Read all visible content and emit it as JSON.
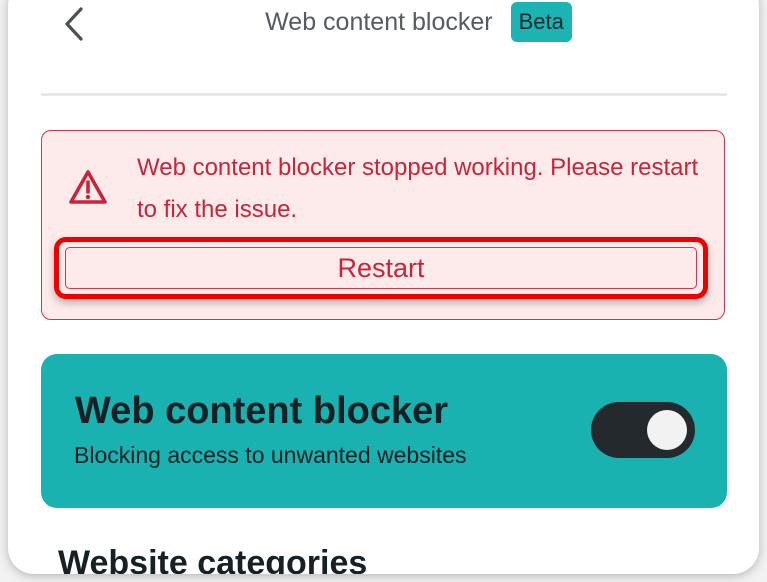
{
  "header": {
    "back_icon": "chevron-left-icon",
    "title": "Web content blocker",
    "badge": "Beta"
  },
  "alert": {
    "icon": "warning-triangle-icon",
    "message": "Web content blocker stopped working. Please restart to fix the issue.",
    "restart_label": "Restart",
    "colors": {
      "text": "#c8243a",
      "background": "#fdeaea",
      "highlight": "#ee0000"
    }
  },
  "blocker_card": {
    "title": "Web content blocker",
    "subtitle": "Blocking access to unwanted websites",
    "toggle_on": true,
    "color": "#1ab1b1"
  },
  "section": {
    "title": "Website categories"
  }
}
